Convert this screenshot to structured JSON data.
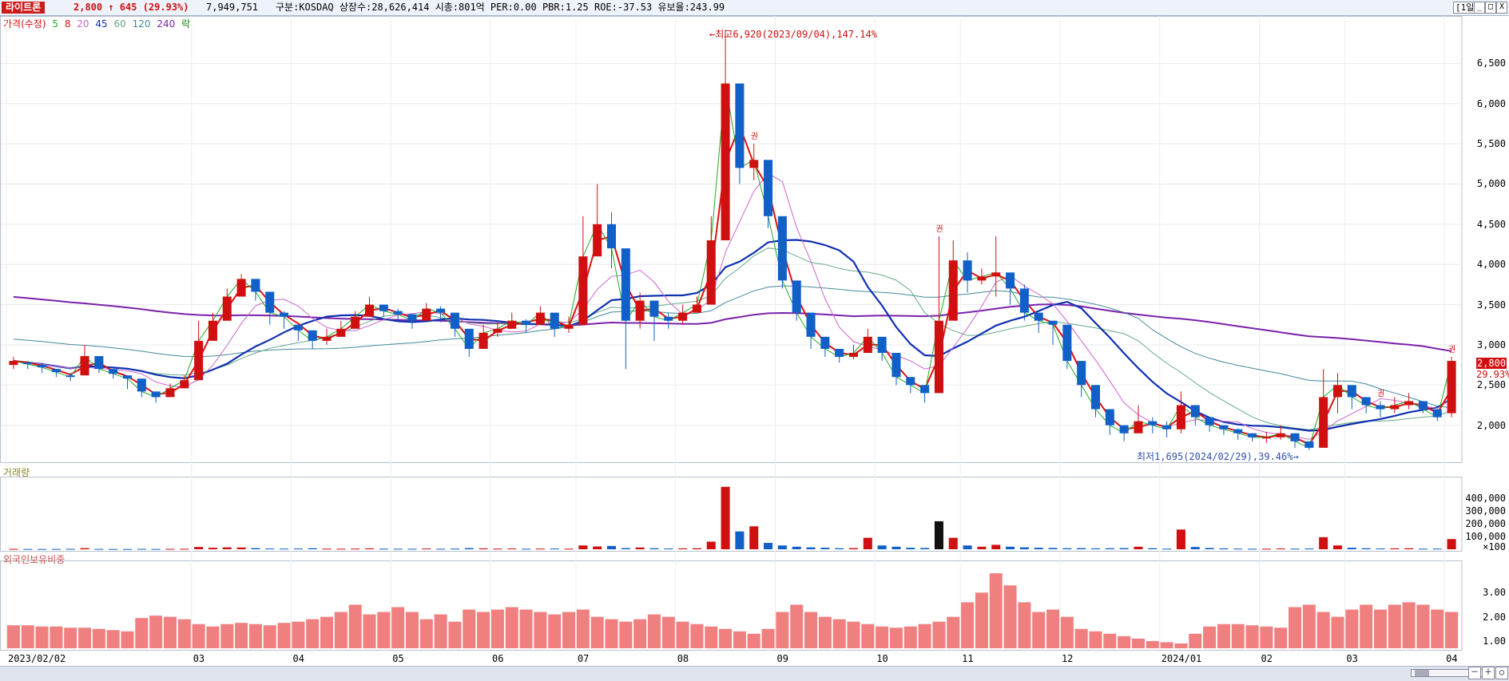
{
  "header": {
    "stock_name": "라이트론",
    "price_line": "2,800 ↑ 645 (29.93%)",
    "volume": "7,949,751",
    "info": "구분:KOSDAQ 상장수:28,626,414 시총:801억 PER:0.00 PBR:1.25 ROE:-37.53 유보율:243.99",
    "period": "[1일]",
    "window_buttons": [
      "_",
      "□",
      "X"
    ]
  },
  "legend": {
    "price_label": "가격(수정)",
    "ma_labels": [
      "5",
      "8",
      "20",
      "45",
      "60",
      "120",
      "240"
    ],
    "extra_label": "락",
    "colors": {
      "up": "#d01010",
      "down": "#1060c8",
      "ma5": "#22aa22",
      "ma8": "#dd1111",
      "ma20": "#cc66cc",
      "ma45": "#1030b0",
      "ma60": "#66aa88",
      "ma120": "#448899",
      "ma240": "#7a22aa",
      "foreign": "#f08080"
    }
  },
  "annotations": {
    "high": "최고6,920(2023/09/04),147.14%",
    "low": "최저1,695(2024/02/29),39.46%",
    "last_price": "2,800",
    "last_change": "29.93%",
    "rights_marker": "권"
  },
  "volume_panel": {
    "title": "거래량",
    "unit": "×100"
  },
  "foreign_panel": {
    "title": "외국인보유비중"
  },
  "chart_data": [
    {
      "type": "candlestick",
      "title": "가격(수정)",
      "x_labels": [
        "2023/02/02",
        "03",
        "04",
        "05",
        "06",
        "07",
        "08",
        "09",
        "10",
        "11",
        "12",
        "2024/01",
        "02",
        "03",
        "04"
      ],
      "yticks": [
        2000,
        2500,
        3000,
        3500,
        4000,
        4500,
        5000,
        5500,
        6000,
        6500
      ],
      "ylim": [
        1550,
        7050
      ],
      "closes": [
        2800,
        2760,
        2720,
        2660,
        2600,
        2860,
        2700,
        2640,
        2580,
        2420,
        2350,
        2460,
        2560,
        3050,
        3300,
        3600,
        3820,
        3660,
        3400,
        3350,
        3180,
        3050,
        3100,
        3200,
        3350,
        3500,
        3420,
        3380,
        3300,
        3450,
        3400,
        3200,
        2950,
        3150,
        3200,
        3300,
        3250,
        3400,
        3200,
        3250,
        4100,
        4500,
        4200,
        3300,
        3550,
        3350,
        3300,
        3400,
        3500,
        4300,
        6250,
        5200,
        5300,
        4600,
        3800,
        3400,
        3100,
        2950,
        2850,
        2900,
        3100,
        2900,
        2600,
        2500,
        2400,
        3300,
        4050,
        3800,
        3850,
        3900,
        3700,
        3400,
        3300,
        3250,
        2800,
        2500,
        2200,
        2000,
        1900,
        2050,
        2000,
        1950,
        2250,
        2100,
        2000,
        1950,
        1900,
        1850,
        1850,
        1900,
        1800,
        1720,
        2350,
        2500,
        2350,
        2250,
        2200,
        2250,
        2300,
        2200,
        2100,
        2800
      ],
      "highs": [
        2850,
        2800,
        2780,
        2700,
        2650,
        3000,
        2780,
        2700,
        2620,
        2480,
        2400,
        2520,
        2620,
        3300,
        3400,
        3700,
        3880,
        3750,
        3500,
        3420,
        3250,
        3110,
        3200,
        3300,
        3420,
        3600,
        3500,
        3450,
        3380,
        3520,
        3480,
        3300,
        3050,
        3250,
        3280,
        3400,
        3320,
        3480,
        3300,
        3350,
        4600,
        5000,
        4650,
        3500,
        3650,
        3480,
        3400,
        3500,
        3600,
        4600,
        6920,
        5400,
        5500,
        4800,
        4000,
        3550,
        3200,
        3050,
        2950,
        3000,
        3200,
        3000,
        2700,
        2600,
        2500,
        4350,
        4300,
        4150,
        3950,
        4350,
        3800,
        3750,
        3400,
        3300,
        2900,
        2600,
        2300,
        2100,
        2000,
        2250,
        2100,
        2050,
        2420,
        2200,
        2100,
        2000,
        1960,
        1900,
        1920,
        2000,
        1900,
        1780,
        2700,
        2650,
        2400,
        2350,
        2300,
        2350,
        2400,
        2300,
        2200,
        2850
      ],
      "lows": [
        2700,
        2700,
        2650,
        2600,
        2550,
        2700,
        2650,
        2580,
        2450,
        2350,
        2280,
        2400,
        2500,
        2950,
        3250,
        3550,
        3700,
        3550,
        3250,
        3200,
        3050,
        2950,
        3000,
        3100,
        3250,
        3400,
        3350,
        3300,
        3200,
        3350,
        3280,
        3100,
        2850,
        3050,
        3100,
        3200,
        3150,
        3300,
        3100,
        3150,
        4000,
        4200,
        3950,
        2700,
        3200,
        3050,
        3200,
        3250,
        3400,
        4200,
        5800,
        5000,
        5050,
        4450,
        3700,
        3300,
        2950,
        2850,
        2780,
        2820,
        2950,
        2800,
        2500,
        2400,
        2280,
        2600,
        3850,
        3650,
        3750,
        3600,
        3500,
        3300,
        3150,
        3000,
        2700,
        2350,
        2100,
        1880,
        1800,
        1950,
        1900,
        1850,
        1900,
        2000,
        1920,
        1880,
        1820,
        1800,
        1780,
        1820,
        1720,
        1695,
        1900,
        2150,
        2200,
        2150,
        2100,
        2150,
        2200,
        2150,
        2050,
        2100
      ],
      "opens": [
        2750,
        2780,
        2750,
        2700,
        2620,
        2620,
        2860,
        2700,
        2620,
        2580,
        2420,
        2350,
        2460,
        2560,
        3050,
        3300,
        3600,
        3820,
        3660,
        3400,
        3250,
        3180,
        3050,
        3100,
        3200,
        3350,
        3500,
        3420,
        3380,
        3300,
        3450,
        3400,
        3200,
        2950,
        3150,
        3200,
        3300,
        3250,
        3400,
        3200,
        3250,
        4100,
        4500,
        4200,
        3300,
        3550,
        3350,
        3300,
        3400,
        3500,
        4300,
        6250,
        5200,
        5300,
        4600,
        3800,
        3400,
        3100,
        2950,
        2850,
        2900,
        3100,
        2900,
        2600,
        2500,
        2400,
        3300,
        4050,
        3800,
        3850,
        3900,
        3700,
        3400,
        3300,
        3250,
        2800,
        2500,
        2200,
        2000,
        1900,
        2050,
        2000,
        1950,
        2250,
        2100,
        2000,
        1950,
        1900,
        1850,
        1850,
        1900,
        1800,
        1720,
        2350,
        2500,
        2350,
        2250,
        2200,
        2250,
        2300,
        2200,
        2150
      ]
    },
    {
      "type": "bar",
      "title": "거래량",
      "yticks": [
        100000,
        200000,
        300000,
        400000
      ],
      "ylim": [
        0,
        520000
      ],
      "values": [
        3000,
        2000,
        2000,
        2500,
        3000,
        9000,
        3000,
        2000,
        2000,
        3000,
        2000,
        3000,
        4000,
        18000,
        12000,
        15000,
        14000,
        9000,
        6000,
        5000,
        6000,
        8000,
        5000,
        4000,
        5000,
        7000,
        5000,
        4000,
        4000,
        6000,
        4000,
        5000,
        9000,
        7000,
        5000,
        6000,
        4000,
        5000,
        6000,
        5000,
        30000,
        22000,
        26000,
        9000,
        14000,
        8000,
        6000,
        7000,
        8000,
        60000,
        490000,
        140000,
        180000,
        50000,
        30000,
        20000,
        15000,
        12000,
        8000,
        9000,
        90000,
        30000,
        20000,
        12000,
        10000,
        220000,
        90000,
        30000,
        20000,
        35000,
        20000,
        15000,
        12000,
        10000,
        8000,
        9000,
        7000,
        8000,
        9000,
        20000,
        8000,
        5000,
        155000,
        18000,
        10000,
        7000,
        5000,
        4000,
        4000,
        6000,
        5000,
        6000,
        95000,
        30000,
        12000,
        8000,
        6000,
        7000,
        8000,
        5000,
        5000,
        80000
      ]
    },
    {
      "type": "bar",
      "title": "외국인보유비중",
      "yticks": [
        1.0,
        2.0,
        3.0
      ],
      "ylim": [
        0.7,
        4.0
      ],
      "values": [
        1.65,
        1.65,
        1.6,
        1.6,
        1.55,
        1.55,
        1.5,
        1.45,
        1.4,
        1.95,
        2.05,
        2.0,
        1.9,
        1.7,
        1.6,
        1.7,
        1.75,
        1.7,
        1.65,
        1.75,
        1.8,
        1.9,
        2.0,
        2.2,
        2.5,
        2.1,
        2.2,
        2.4,
        2.2,
        1.9,
        2.1,
        1.8,
        2.3,
        2.2,
        2.3,
        2.4,
        2.3,
        2.2,
        2.1,
        2.2,
        2.3,
        2.0,
        1.9,
        1.8,
        1.9,
        2.1,
        2.0,
        1.8,
        1.7,
        1.6,
        1.5,
        1.4,
        1.3,
        1.5,
        2.2,
        2.5,
        2.2,
        2.0,
        1.9,
        1.8,
        1.7,
        1.6,
        1.55,
        1.6,
        1.7,
        1.8,
        2.0,
        2.6,
        3.0,
        3.8,
        3.3,
        2.6,
        2.2,
        2.3,
        2.0,
        1.5,
        1.4,
        1.3,
        1.2,
        1.1,
        1.0,
        0.95,
        0.9,
        1.3,
        1.6,
        1.7,
        1.7,
        1.65,
        1.6,
        1.55,
        2.4,
        2.5,
        2.2,
        2.0,
        2.3,
        2.5,
        2.3,
        2.5,
        2.6,
        2.5,
        2.3,
        2.2
      ]
    }
  ]
}
